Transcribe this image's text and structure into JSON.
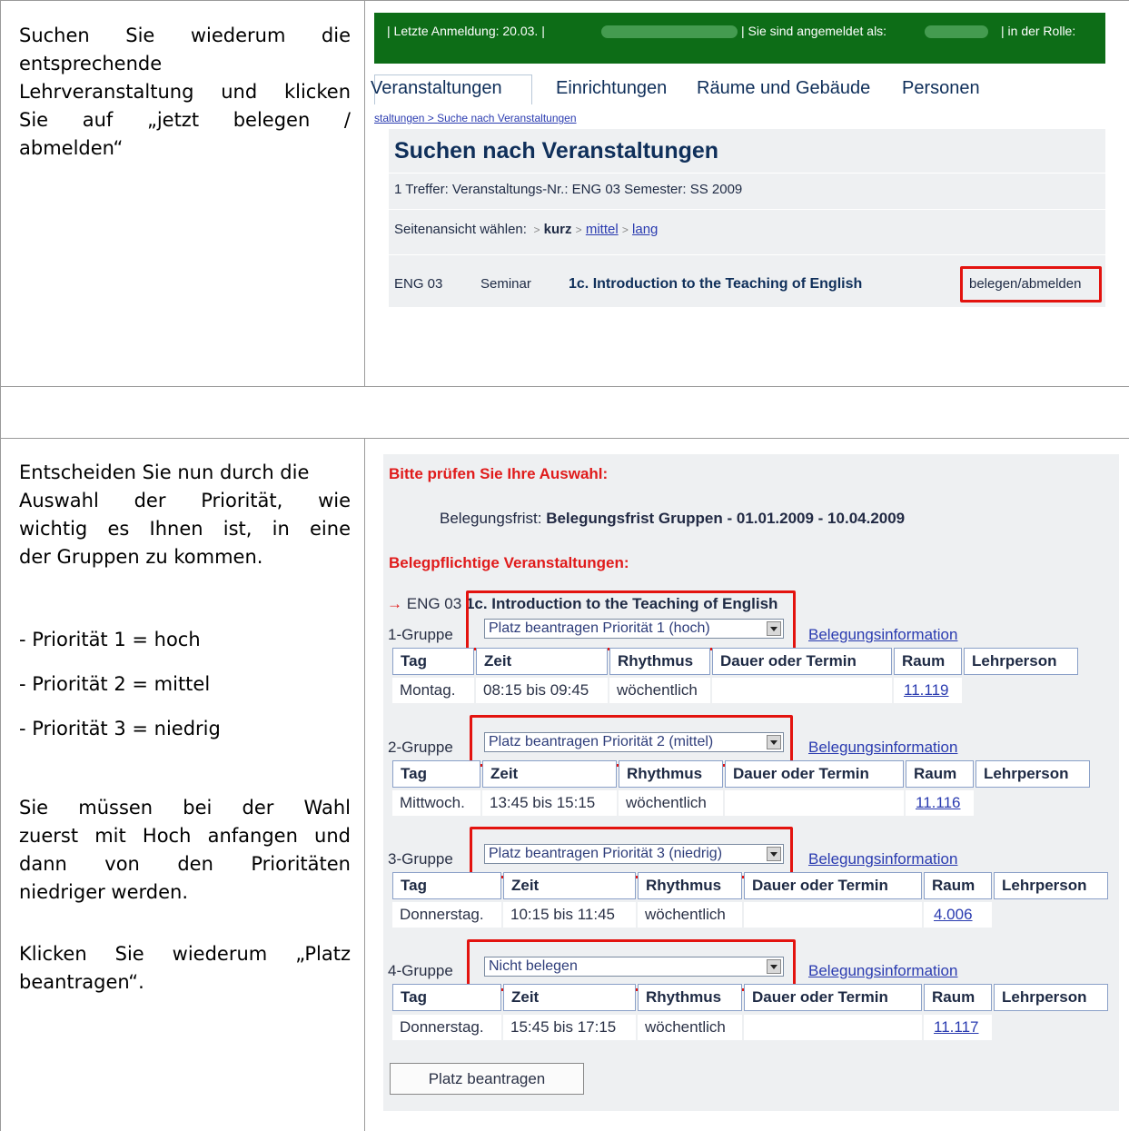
{
  "row1": {
    "instruction": [
      "Suchen Sie wiederum die entsprechende Lehrveranstaltung und klicken Sie auf „jetzt belegen / abmelden“"
    ],
    "lines": [
      "Suchen Sie wiederum die",
      "entsprechende",
      "Lehrveranstaltung und klicken",
      "Sie auf „jetzt belegen /",
      "abmelden“"
    ],
    "topbar": {
      "last_login": "| Letzte Anmeldung:  20.03.  |",
      "logged_in_as": "| Sie sind angemeldet als:",
      "role": "|   in der Rolle:"
    },
    "tabs": [
      "Veranstaltungen",
      "Einrichtungen",
      "Räume und Gebäude",
      "Personen"
    ],
    "breadcrumb": [
      "staltungen",
      "Suche nach Veranstaltungen"
    ],
    "breadcrumb_sep": " > ",
    "title": "Suchen nach Veranstaltungen",
    "hits": "1 Treffer: Veranstaltungs-Nr.: ENG 03    Semester: SS 2009",
    "view_label": "Seitenansicht wählen:",
    "views": [
      "kurz",
      "mittel",
      "lang"
    ],
    "result": {
      "number": "ENG 03",
      "type": "Seminar",
      "name": "1c. Introduction to the Teaching of English",
      "action": "belegen/abmelden"
    }
  },
  "row2": {
    "p1": "Entscheiden Sie nun durch die Auswahl der Priorität, wie wichtig es Ihnen ist, in eine der Gruppen zu kommen.",
    "p1_lines": [
      "Entscheiden Sie nun durch die",
      "Auswahl der Priorität, wie",
      "wichtig es Ihnen ist, in eine",
      "der Gruppen zu kommen."
    ],
    "priorities": [
      "- Priorität 1 = hoch",
      "- Priorität 2 = mittel",
      "- Priorität 3 = niedrig"
    ],
    "p2_lines": [
      "Sie müssen bei der Wahl",
      "zuerst mit Hoch anfangen und",
      "dann von den Prioritäten",
      "niedriger werden."
    ],
    "p3_lines": [
      "Klicken Sie wiederum „Platz",
      "beantragen“."
    ],
    "check_heading": "Bitte prüfen Sie Ihre Auswahl:",
    "deadline_label": "Belegungsfrist:",
    "deadline_value": "Belegungsfrist Gruppen - 01.01.2009 - 10.04.2009",
    "mandatory_heading": "Belegpflichtige Veranstaltungen:",
    "course_arrow": "→",
    "course_number": "ENG 03",
    "course_name": "1c. Introduction to the Teaching of English",
    "info_link": "Belegungsinformation",
    "table_headers": [
      "Tag",
      "Zeit",
      "Rhythmus",
      "Dauer oder Termin",
      "Raum",
      "Lehrperson"
    ],
    "groups": [
      {
        "label": "1-Gruppe",
        "select": "Platz beantragen Priorität 1 (hoch)",
        "day": "Montag.",
        "time": "08:15 bis 09:45",
        "rhythm": "wöchentlich",
        "room": "11.119"
      },
      {
        "label": "2-Gruppe",
        "select": "Platz beantragen Priorität 2 (mittel)",
        "day": "Mittwoch.",
        "time": "13:45 bis 15:15",
        "rhythm": "wöchentlich",
        "room": "11.116"
      },
      {
        "label": "3-Gruppe",
        "select": "Platz beantragen Priorität 3 (niedrig)",
        "day": "Donnerstag.",
        "time": "10:15 bis 11:45",
        "rhythm": "wöchentlich",
        "room": "4.006"
      },
      {
        "label": "4-Gruppe",
        "select": "Nicht belegen",
        "day": "Donnerstag.",
        "time": "15:45 bis 17:15",
        "rhythm": "wöchentlich",
        "room": "11.117"
      }
    ],
    "submit_button": "Platz beantragen"
  },
  "colors": {
    "green_bar": "#0d6d17",
    "highlight": "#e3130f",
    "red_heading": "#e01b1b",
    "link": "#2a3bb0"
  }
}
